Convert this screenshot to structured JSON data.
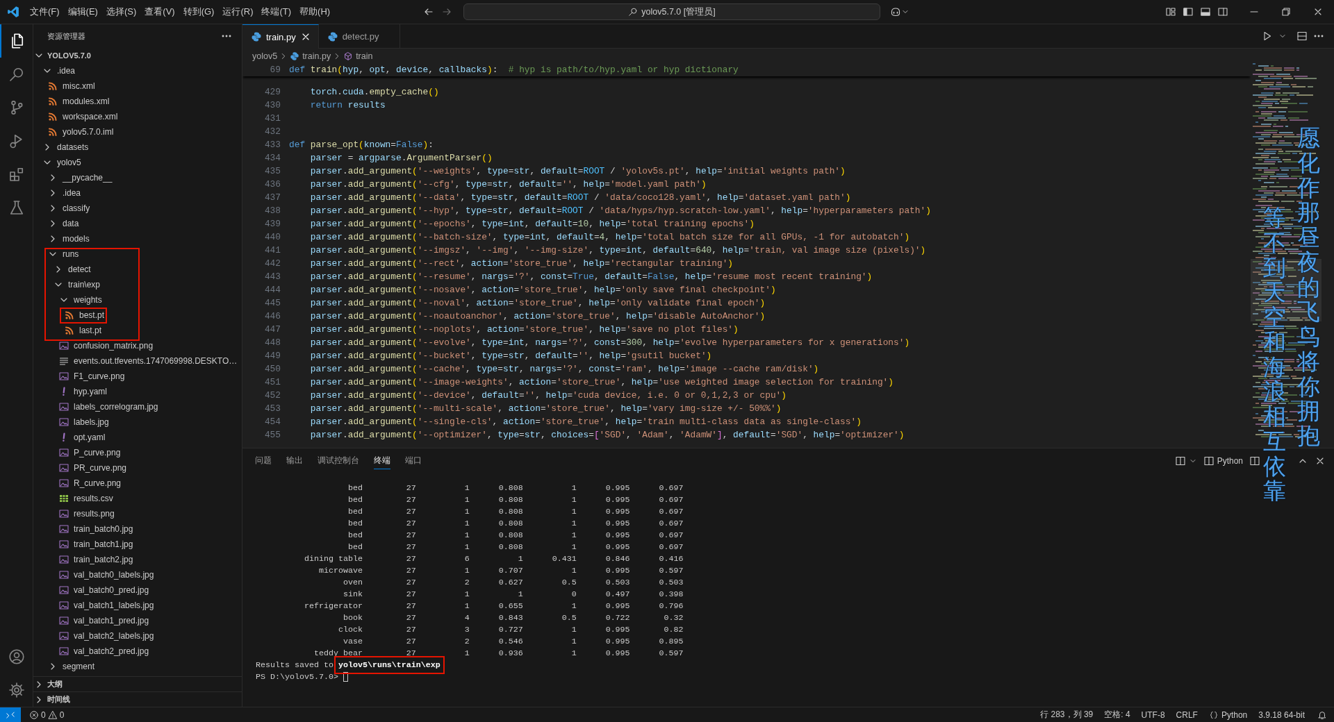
{
  "title_bar": {
    "menu": [
      "文件(F)",
      "编辑(E)",
      "选择(S)",
      "查看(V)",
      "转到(G)",
      "运行(R)",
      "终端(T)",
      "帮助(H)"
    ],
    "search": "yolov5.7.0 [管理员]"
  },
  "activity_bar": {
    "items": [
      {
        "kind": "explorer",
        "selected": true
      },
      {
        "kind": "search",
        "selected": false
      },
      {
        "kind": "source_control",
        "selected": false
      },
      {
        "kind": "run_debug",
        "selected": false
      },
      {
        "kind": "extensions",
        "selected": false
      },
      {
        "kind": "testing",
        "selected": false
      }
    ],
    "bottom": [
      {
        "kind": "account"
      },
      {
        "kind": "settings"
      }
    ]
  },
  "sidebar": {
    "title": "资源管理器",
    "root": {
      "label": "YOLOV5.7.0",
      "expanded": true
    },
    "tree": [
      {
        "label": ".idea",
        "kind": "folder",
        "expanded": true,
        "boxed": false,
        "marked": false,
        "children": [
          {
            "label": "misc.xml",
            "kind": "xml",
            "boxed": false,
            "marked": false
          },
          {
            "label": "modules.xml",
            "kind": "xml",
            "boxed": false,
            "marked": false
          },
          {
            "label": "workspace.xml",
            "kind": "xml",
            "boxed": false,
            "marked": false
          },
          {
            "label": "yolov5.7.0.iml",
            "kind": "xml",
            "boxed": false,
            "marked": false
          }
        ]
      },
      {
        "label": "datasets",
        "kind": "folder",
        "expanded": false,
        "boxed": false,
        "marked": false
      },
      {
        "label": "yolov5",
        "kind": "folder",
        "expanded": true,
        "boxed": false,
        "marked": false,
        "children": [
          {
            "label": "__pycache__",
            "kind": "folder",
            "expanded": false,
            "boxed": false,
            "marked": false
          },
          {
            "label": ".idea",
            "kind": "folder",
            "expanded": false,
            "boxed": false,
            "marked": false
          },
          {
            "label": "classify",
            "kind": "folder",
            "expanded": false,
            "boxed": false,
            "marked": false
          },
          {
            "label": "data",
            "kind": "folder",
            "expanded": false,
            "boxed": false,
            "marked": false
          },
          {
            "label": "models",
            "kind": "folder",
            "expanded": false,
            "boxed": false,
            "marked": false
          },
          {
            "label": "runs",
            "kind": "folder",
            "expanded": true,
            "boxed": true,
            "marked": false,
            "children": [
              {
                "label": "detect",
                "kind": "folder",
                "expanded": false,
                "boxed": true,
                "marked": false
              },
              {
                "label": "train\\exp",
                "kind": "folder",
                "expanded": true,
                "boxed": true,
                "marked": false,
                "children": [
                  {
                    "label": "weights",
                    "kind": "folder",
                    "expanded": true,
                    "boxed": true,
                    "marked": false,
                    "children": [
                      {
                        "label": "best.pt",
                        "kind": "model",
                        "boxed": true,
                        "marked": true
                      },
                      {
                        "label": "last.pt",
                        "kind": "model",
                        "boxed": true,
                        "marked": false
                      }
                    ]
                  },
                  {
                    "label": "confusion_matrix.png",
                    "kind": "image",
                    "boxed": false,
                    "marked": false
                  },
                  {
                    "label": "events.out.tfevents.1747069998.DESKTO…",
                    "kind": "log",
                    "boxed": false,
                    "marked": false
                  },
                  {
                    "label": "F1_curve.png",
                    "kind": "image",
                    "boxed": false,
                    "marked": false
                  },
                  {
                    "label": "hyp.yaml",
                    "kind": "yaml",
                    "boxed": false,
                    "marked": false
                  },
                  {
                    "label": "labels_correlogram.jpg",
                    "kind": "image",
                    "boxed": false,
                    "marked": false
                  },
                  {
                    "label": "labels.jpg",
                    "kind": "image",
                    "boxed": false,
                    "marked": false
                  },
                  {
                    "label": "opt.yaml",
                    "kind": "yaml",
                    "boxed": false,
                    "marked": false
                  },
                  {
                    "label": "P_curve.png",
                    "kind": "image",
                    "boxed": false,
                    "marked": false
                  },
                  {
                    "label": "PR_curve.png",
                    "kind": "image",
                    "boxed": false,
                    "marked": false
                  },
                  {
                    "label": "R_curve.png",
                    "kind": "image",
                    "boxed": false,
                    "marked": false
                  },
                  {
                    "label": "results.csv",
                    "kind": "csv",
                    "boxed": false,
                    "marked": false
                  },
                  {
                    "label": "results.png",
                    "kind": "image",
                    "boxed": false,
                    "marked": false
                  },
                  {
                    "label": "train_batch0.jpg",
                    "kind": "image",
                    "boxed": false,
                    "marked": false
                  },
                  {
                    "label": "train_batch1.jpg",
                    "kind": "image",
                    "boxed": false,
                    "marked": false
                  },
                  {
                    "label": "train_batch2.jpg",
                    "kind": "image",
                    "boxed": false,
                    "marked": false
                  },
                  {
                    "label": "val_batch0_labels.jpg",
                    "kind": "image",
                    "boxed": false,
                    "marked": false
                  },
                  {
                    "label": "val_batch0_pred.jpg",
                    "kind": "image",
                    "boxed": false,
                    "marked": false
                  },
                  {
                    "label": "val_batch1_labels.jpg",
                    "kind": "image",
                    "boxed": false,
                    "marked": false
                  },
                  {
                    "label": "val_batch1_pred.jpg",
                    "kind": "image",
                    "boxed": false,
                    "marked": false
                  },
                  {
                    "label": "val_batch2_labels.jpg",
                    "kind": "image",
                    "boxed": false,
                    "marked": false
                  },
                  {
                    "label": "val_batch2_pred.jpg",
                    "kind": "image",
                    "boxed": false,
                    "marked": false
                  }
                ]
              }
            ]
          },
          {
            "label": "segment",
            "kind": "folder",
            "expanded": false,
            "boxed": false,
            "marked": false
          }
        ]
      }
    ],
    "sections": [
      {
        "label": "大纲",
        "expanded": false
      },
      {
        "label": "时间线",
        "expanded": false
      }
    ]
  },
  "editor": {
    "tabs": [
      {
        "label": "train.py",
        "selected": true
      },
      {
        "label": "detect.py",
        "selected": false
      }
    ],
    "breadcrumb": [
      "yolov5",
      "train.py",
      "train"
    ],
    "sticky_line": {
      "number": "69",
      "code": "def train(hyp, opt, device, callbacks):  # hyp is path/to/hyp.yaml or hyp dictionary"
    },
    "lines": [
      {
        "number": "429",
        "code": "    torch.cuda.empty_cache()"
      },
      {
        "number": "430",
        "code": "    return results"
      },
      {
        "number": "431"
      },
      {
        "number": "432"
      },
      {
        "number": "433",
        "code": "def parse_opt(known=False):"
      },
      {
        "number": "434",
        "code": "    parser = argparse.ArgumentParser()"
      },
      {
        "number": "435",
        "code": "    parser.add_argument('--weights', type=str, default=ROOT / 'yolov5s.pt', help='initial weights path')"
      },
      {
        "number": "436",
        "code": "    parser.add_argument('--cfg', type=str, default='', help='model.yaml path')"
      },
      {
        "number": "437",
        "code": "    parser.add_argument('--data', type=str, default=ROOT / 'data/coco128.yaml', help='dataset.yaml path')"
      },
      {
        "number": "438",
        "code": "    parser.add_argument('--hyp', type=str, default=ROOT / 'data/hyps/hyp.scratch-low.yaml', help='hyperparameters path')"
      },
      {
        "number": "439",
        "code": "    parser.add_argument('--epochs', type=int, default=10, help='total training epochs')"
      },
      {
        "number": "440",
        "code": "    parser.add_argument('--batch-size', type=int, default=4, help='total batch size for all GPUs, -1 for autobatch')"
      },
      {
        "number": "441",
        "code": "    parser.add_argument('--imgsz', '--img', '--img-size', type=int, default=640, help='train, val image size (pixels)')"
      },
      {
        "number": "442",
        "code": "    parser.add_argument('--rect', action='store_true', help='rectangular training')"
      },
      {
        "number": "443",
        "code": "    parser.add_argument('--resume', nargs='?', const=True, default=False, help='resume most recent training')"
      },
      {
        "number": "444",
        "code": "    parser.add_argument('--nosave', action='store_true', help='only save final checkpoint')"
      },
      {
        "number": "445",
        "code": "    parser.add_argument('--noval', action='store_true', help='only validate final epoch')"
      },
      {
        "number": "446",
        "code": "    parser.add_argument('--noautoanchor', action='store_true', help='disable AutoAnchor')"
      },
      {
        "number": "447",
        "code": "    parser.add_argument('--noplots', action='store_true', help='save no plot files')"
      },
      {
        "number": "448",
        "code": "    parser.add_argument('--evolve', type=int, nargs='?', const=300, help='evolve hyperparameters for x generations')"
      },
      {
        "number": "449",
        "code": "    parser.add_argument('--bucket', type=str, default='', help='gsutil bucket')"
      },
      {
        "number": "450",
        "code": "    parser.add_argument('--cache', type=str, nargs='?', const='ram', help='image --cache ram/disk')"
      },
      {
        "number": "451",
        "code": "    parser.add_argument('--image-weights', action='store_true', help='use weighted image selection for training')"
      },
      {
        "number": "452",
        "code": "    parser.add_argument('--device', default='', help='cuda device, i.e. 0 or 0,1,2,3 or cpu')"
      },
      {
        "number": "453",
        "code": "    parser.add_argument('--multi-scale', action='store_true', help='vary img-size +/- 50%%')"
      },
      {
        "number": "454",
        "code": "    parser.add_argument('--single-cls', action='store_true', help='train multi-class data as single-class')"
      },
      {
        "number": "455",
        "code": "    parser.add_argument('--optimizer', type=str, choices=['SGD', 'Adam', 'AdamW'], default='SGD', help='optimizer')"
      }
    ]
  },
  "panel": {
    "tabs": [
      {
        "label": "问题",
        "selected": false
      },
      {
        "label": "输出",
        "selected": false
      },
      {
        "label": "调试控制台",
        "selected": false
      },
      {
        "label": "终端",
        "selected": true
      },
      {
        "label": "端口",
        "selected": false
      }
    ],
    "terminal_name": "Python",
    "rows": [
      [
        "bed",
        "27",
        "1",
        "0.808",
        "1",
        "0.995",
        "0.697"
      ],
      [
        "bed",
        "27",
        "1",
        "0.808",
        "1",
        "0.995",
        "0.697"
      ],
      [
        "bed",
        "27",
        "1",
        "0.808",
        "1",
        "0.995",
        "0.697"
      ],
      [
        "bed",
        "27",
        "1",
        "0.808",
        "1",
        "0.995",
        "0.697"
      ],
      [
        "bed",
        "27",
        "1",
        "0.808",
        "1",
        "0.995",
        "0.697"
      ],
      [
        "bed",
        "27",
        "1",
        "0.808",
        "1",
        "0.995",
        "0.697"
      ],
      [
        "dining table",
        "27",
        "6",
        "1",
        "0.431",
        "0.846",
        "0.416"
      ],
      [
        "microwave",
        "27",
        "1",
        "0.707",
        "1",
        "0.995",
        "0.597"
      ],
      [
        "oven",
        "27",
        "2",
        "0.627",
        "0.5",
        "0.503",
        "0.503"
      ],
      [
        "sink",
        "27",
        "1",
        "1",
        "0",
        "0.497",
        "0.398"
      ],
      [
        "refrigerator",
        "27",
        "1",
        "0.655",
        "1",
        "0.995",
        "0.796"
      ],
      [
        "book",
        "27",
        "4",
        "0.843",
        "0.5",
        "0.722",
        "0.32"
      ],
      [
        "clock",
        "27",
        "3",
        "0.727",
        "1",
        "0.995",
        "0.82"
      ],
      [
        "vase",
        "27",
        "2",
        "0.546",
        "1",
        "0.995",
        "0.895"
      ],
      [
        "teddy bear",
        "27",
        "1",
        "0.936",
        "1",
        "0.995",
        "0.597"
      ]
    ],
    "result": "Results saved to **yolov5\\runs\\train\\exp**",
    "result_highlighted": true,
    "prompt": "PS D:\\yolov5.7.0>"
  },
  "lyrics": [
    "愿化作那昼夜的飞鸟将你拥抱",
    "等不到天空和海浪相互依靠"
  ],
  "status_bar": {
    "errors": "0",
    "warnings": "0",
    "items": [
      {
        "kind": "text",
        "label": "行 283，列 39"
      },
      {
        "kind": "text",
        "label": "空格: 4"
      },
      {
        "kind": "text",
        "label": "UTF-8"
      },
      {
        "kind": "text",
        "label": "CRLF"
      },
      {
        "kind": "language",
        "label": "Python"
      },
      {
        "kind": "text",
        "label": "3.9.18 64-bit"
      }
    ]
  }
}
